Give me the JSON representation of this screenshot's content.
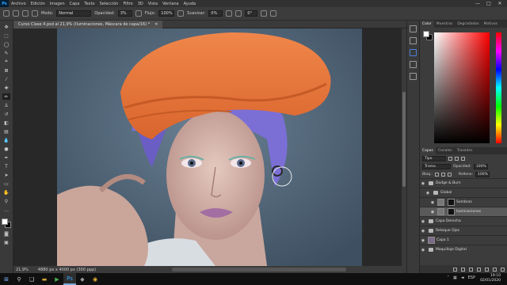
{
  "menubar": {
    "app_badge": "Ps",
    "items": [
      "Archivo",
      "Edición",
      "Imagen",
      "Capa",
      "Texto",
      "Selección",
      "Filtro",
      "3D",
      "Vista",
      "Ventana",
      "Ayuda"
    ],
    "window_controls": [
      "—",
      "□",
      "✕"
    ]
  },
  "options": {
    "mode_label": "Modo:",
    "mode_value": "Normal",
    "opacity_label": "Opacidad:",
    "opacity_value": "3%",
    "flow_label": "Flujo:",
    "flow_value": "100%",
    "smoothing_label": "Suavizar:",
    "smoothing_value": "0%",
    "angle_value": "0°"
  },
  "document": {
    "tab_title": "Curso Clase 4.psd al 21,9% (Iluminaciones, Máscara de capa/16) *",
    "zoom": "21,9%",
    "size": "4880 px x 4000 px (300 ppp)"
  },
  "color_panel": {
    "tabs": [
      "Color",
      "Muestras",
      "Degradados",
      "Motivos"
    ],
    "foreground": "#ffffff",
    "background": "#000000"
  },
  "layers_panel": {
    "tabs": [
      "Capas",
      "Canales",
      "Trazados"
    ],
    "filter_value": "Tipo",
    "blend_value": "Trama",
    "opacity_label": "Opacidad:",
    "opacity_value": "100%",
    "lock_label": "Bloq.:",
    "fill_label": "Relleno:",
    "fill_value": "100%",
    "layers": [
      {
        "name": "Dodge & Burn",
        "kind": "folder"
      },
      {
        "name": "Global",
        "kind": "folder"
      },
      {
        "name": "Sombras",
        "kind": "mask"
      },
      {
        "name": "Iluminaciones",
        "kind": "mask",
        "selected": true
      },
      {
        "name": "Capa Derecha",
        "kind": "folder"
      },
      {
        "name": "Retoque Ojos",
        "kind": "folder"
      },
      {
        "name": "Capa 1",
        "kind": "image"
      },
      {
        "name": "Maquillaje Digital",
        "kind": "folder"
      }
    ]
  },
  "taskbar": {
    "time": "19:10",
    "date": "02/01/2020",
    "language": "ESP"
  }
}
